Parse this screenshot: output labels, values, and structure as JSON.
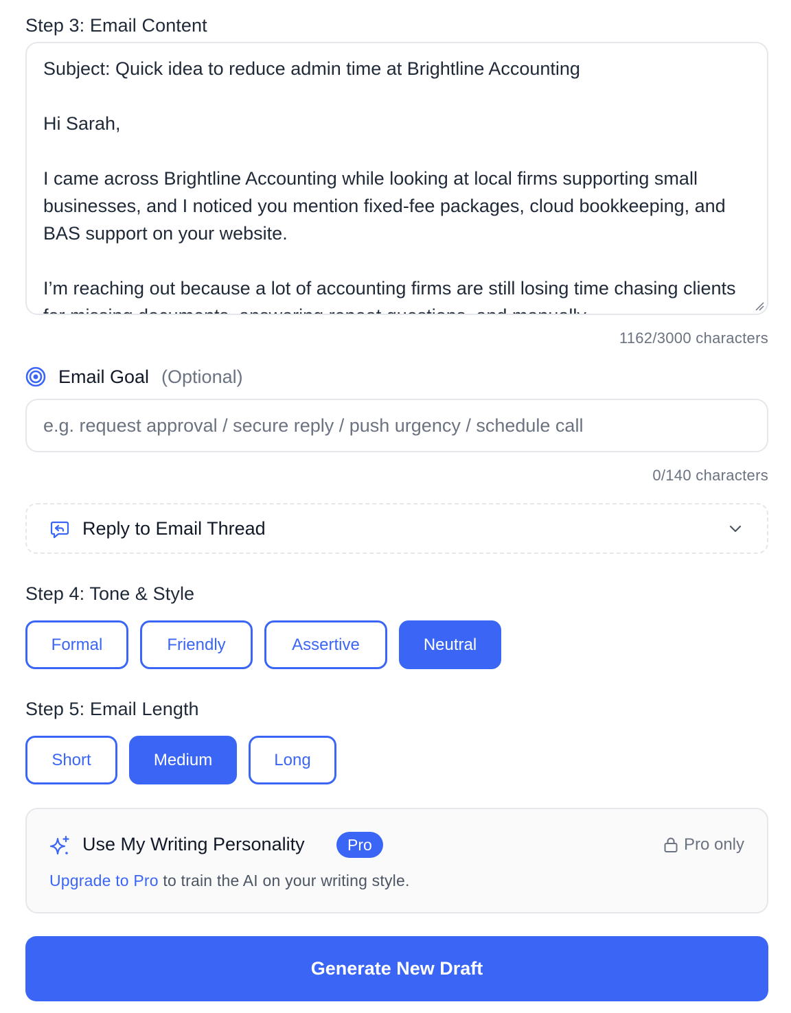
{
  "step3": {
    "label": "Step 3: Email Content",
    "content": "Subject: Quick idea to reduce admin time at Brightline Accounting\n\nHi Sarah,\n\nI came across Brightline Accounting while looking at local firms supporting small businesses, and I noticed you mention fixed-fee packages, cloud bookkeeping, and BAS support on your website.\n\nI’m reaching out because a lot of accounting firms are still losing time chasing clients for missing documents, answering repeat questions, and manually",
    "char_count": "1162/3000 characters"
  },
  "goal": {
    "label": "Email Goal",
    "optional": "(Optional)",
    "placeholder": "e.g. request approval / secure reply / push urgency / schedule call",
    "value": "",
    "char_count": "0/140 characters",
    "icon": "target-icon"
  },
  "reply_thread": {
    "label": "Reply to Email Thread",
    "icon": "reply-message-icon",
    "expand_icon": "chevron-down-icon"
  },
  "step4": {
    "label": "Step 4: Tone & Style",
    "options": [
      "Formal",
      "Friendly",
      "Assertive",
      "Neutral"
    ],
    "selected": "Neutral"
  },
  "step5": {
    "label": "Step 5: Email Length",
    "options": [
      "Short",
      "Medium",
      "Long"
    ],
    "selected": "Medium"
  },
  "personality": {
    "title": "Use My Writing Personality",
    "badge": "Pro",
    "lock_label": "Pro only",
    "upgrade_link": "Upgrade to Pro",
    "upgrade_text": " to train the AI on your writing style.",
    "icon": "sparkle-icon"
  },
  "generate_button": "Generate New Draft",
  "colors": {
    "accent": "#3b66f5",
    "border": "#e5e7eb",
    "muted_text": "#6b7280"
  }
}
